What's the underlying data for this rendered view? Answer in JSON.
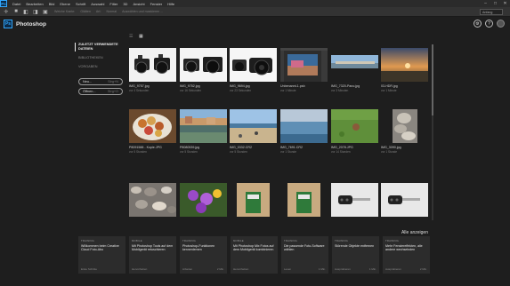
{
  "menubar": {
    "logo": "Ps",
    "items": [
      "Datei",
      "Bearbeiten",
      "Bild",
      "Ebene",
      "Schrift",
      "Auswahl",
      "Filter",
      "3D",
      "Ansicht",
      "Fenster",
      "Hilfe"
    ],
    "window_buttons": [
      "–",
      "□",
      "✕"
    ]
  },
  "optbar": {
    "texts": [
      "Weiche Kante:",
      "Glätten",
      "Art:",
      "Normal",
      "Auswählen und maskieren ..."
    ],
    "search": "Anfang"
  },
  "header": {
    "logo": "Ps",
    "title": "Photoshop",
    "icons": [
      "gear-icon",
      "help-icon",
      "avatar-icon"
    ]
  },
  "nav": {
    "items": [
      "Zuletzt verwendete Dateien",
      "Bibliotheken",
      "Vorgaben"
    ],
    "new_label": "Neu...",
    "new_shortcut": "Strg+N",
    "open_label": "Öffnen...",
    "open_shortcut": "Strg+O"
  },
  "files": [
    {
      "name": "IMG_9757.jpg",
      "meta": "vor 4 Sekunden",
      "img": "cameras"
    },
    {
      "name": "IMG_9752.jpg",
      "meta": "vor 16 Sekunden",
      "img": "camera2"
    },
    {
      "name": "IMG_9694.jpg",
      "meta": "vor 23 Sekunden",
      "img": "camera3"
    },
    {
      "name": "Unbenannt-1.psb",
      "meta": "vor 1 Minute",
      "img": "editor"
    },
    {
      "name": "IMG_7320-Pano.jpg",
      "meta": "vor 3 Minuten",
      "img": "pano"
    },
    {
      "name": "03-HDR.jpg",
      "meta": "vor 1 Minute",
      "img": "sunset"
    },
    {
      "name": "P8091588 - Kopie.JPG",
      "meta": "vor 5 Stunden",
      "img": "food"
    },
    {
      "name": "P8080539.jpg",
      "meta": "vor 5 Stunden",
      "img": "river"
    },
    {
      "name": "IMG_0332.CR2",
      "meta": "vor 5 Stunden",
      "img": "beach"
    },
    {
      "name": "IMG_7691.CR2",
      "meta": "vor 1 Stunde",
      "img": "sea"
    },
    {
      "name": "IMG_2078.JPG",
      "meta": "vor 14 Stunden",
      "img": "grass"
    },
    {
      "name": "IMG_3090.jpg",
      "meta": "vor 1 Stunde",
      "img": "stones"
    },
    {
      "name": "",
      "meta": "",
      "img": "pebbles"
    },
    {
      "name": "",
      "meta": "",
      "img": "flowers"
    },
    {
      "name": "",
      "meta": "",
      "img": "sign"
    },
    {
      "name": "",
      "meta": "",
      "img": "sign"
    },
    {
      "name": "",
      "meta": "",
      "img": "keys"
    },
    {
      "name": "",
      "meta": "",
      "img": "keys"
    }
  ],
  "learn": {
    "show_all": "Alle anzeigen",
    "cards": [
      {
        "tag": "Training",
        "title": "Willkommen beim Creative Cloud Foto-Abo",
        "foot": "Erste Schritte",
        "time": ""
      },
      {
        "tag": "Mobile",
        "title": "Mit Photoshop Tools auf dem Mobilgerät retuschieren",
        "foot": "Hervorheben",
        "time": ""
      },
      {
        "tag": "Training",
        "title": "Photoshop-Funktionen kennenlernen",
        "foot": "Arbeiten",
        "time": "2 Min."
      },
      {
        "tag": "Mobile",
        "title": "Mit Photoshop Mix Fotos auf dem Mobilgerät kombinieren",
        "foot": "Hervorheben",
        "time": ""
      },
      {
        "tag": "Training",
        "title": "Die passende Foto-Software wählen",
        "foot": "Lesen",
        "time": "1 Min."
      },
      {
        "tag": "Training",
        "title": "Störende Objekte entfernen",
        "foot": "Ausprobieren",
        "time": "1 Min."
      },
      {
        "tag": "Training",
        "title": "Mehr Fenstereffekten, alle andere wechselnden",
        "foot": "Ausprobieren",
        "time": "2 Min."
      }
    ]
  },
  "colors": {
    "accent": "#31a8ff",
    "bg": "#1e1e1e",
    "card": "#2c2c2c"
  }
}
